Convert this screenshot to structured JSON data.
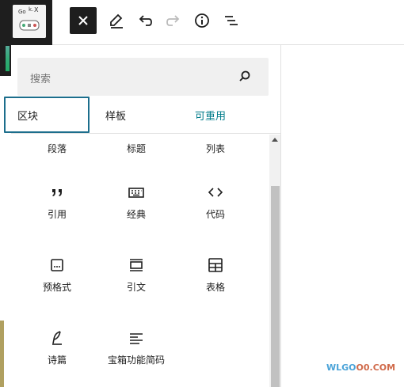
{
  "toolbar": {
    "logo_text": "Gouk.NX",
    "icons": [
      "close-icon",
      "pencil-icon",
      "undo-icon",
      "redo-icon",
      "info-icon",
      "list-view-icon"
    ]
  },
  "inserter": {
    "search_placeholder": "搜索",
    "tabs": [
      {
        "label": "区块",
        "active": true
      },
      {
        "label": "样板",
        "active": false
      },
      {
        "label": "可重用",
        "active": false
      }
    ],
    "blocks": [
      {
        "label": "段落",
        "icon": "paragraph-icon"
      },
      {
        "label": "标题",
        "icon": "heading-icon"
      },
      {
        "label": "列表",
        "icon": "list-icon"
      },
      {
        "label": "引用",
        "icon": "quote-icon"
      },
      {
        "label": "经典",
        "icon": "classic-icon"
      },
      {
        "label": "代码",
        "icon": "code-icon"
      },
      {
        "label": "预格式",
        "icon": "preformatted-icon"
      },
      {
        "label": "引文",
        "icon": "pullquote-icon"
      },
      {
        "label": "表格",
        "icon": "table-icon"
      },
      {
        "label": "诗篇",
        "icon": "verse-icon"
      },
      {
        "label": "宝箱功能简码",
        "icon": "shortcode-icon"
      }
    ]
  },
  "watermark": {
    "text_a": "WLGO",
    "text_b": "O0.COM"
  },
  "colors": {
    "dark": "#1e1e1e",
    "accent": "#007c8a",
    "tab_border": "#1c6e8c",
    "search_bg": "#f0f0f0"
  }
}
